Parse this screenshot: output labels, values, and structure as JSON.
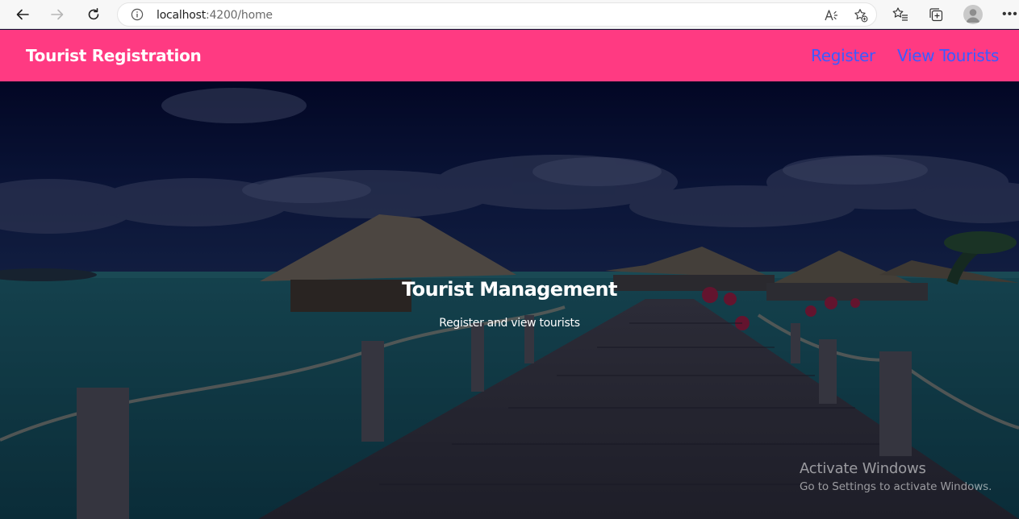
{
  "browser": {
    "url_host": "localhost",
    "url_path": ":4200/home"
  },
  "header": {
    "brand": "Tourist Registration",
    "nav": [
      {
        "label": "Register"
      },
      {
        "label": "View Tourists"
      }
    ]
  },
  "hero": {
    "title": "Tourist Management",
    "subtitle": "Register and view tourists"
  },
  "watermark": {
    "title": "Activate Windows",
    "subtitle": "Go to Settings to activate Windows."
  },
  "colors": {
    "accent": "#ff3a82",
    "nav_link": "#3b5bff",
    "browser_bar": "#f7f7f7"
  },
  "icons": [
    "back-arrow-icon",
    "forward-arrow-icon",
    "refresh-icon",
    "info-icon",
    "read-aloud-icon",
    "add-favorite-icon",
    "favorites-icon",
    "collections-icon",
    "profile-avatar-icon",
    "more-options-icon"
  ]
}
